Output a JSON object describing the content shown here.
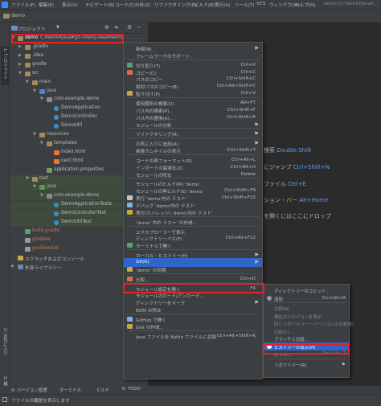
{
  "app": {
    "window_title": "demo [C:¥work¥java¥...",
    "menu": [
      "ファイル(F)",
      "編集(E)",
      "表示(V)",
      "ナビゲート(N)",
      "コード(C)",
      "分析(Z)",
      "リファクタリング(R)",
      "ビルド(B)",
      "実行(U)",
      "ツール(T)",
      "VCS",
      "ウィンドウ(W)",
      "ヘルプ(H)"
    ],
    "breadcrumb": "demo"
  },
  "left_strip": {
    "project_tab": "1: プロジェクト",
    "structure_tab": "2: 構造",
    "favorites_tab": "2: お気に入り"
  },
  "project_panel": {
    "title": "プロジェクト",
    "caret": "▼"
  },
  "tree": {
    "root_name": "demo",
    "root_path": "C:¥work¥java¥git-intellij-idea¥demo",
    "items": [
      {
        "label": ".gradle",
        "indent": 1,
        "arrow": "▶",
        "icon": "folder"
      },
      {
        "label": ".idea",
        "indent": 1,
        "arrow": "▶",
        "icon": "folder"
      },
      {
        "label": "gradle",
        "indent": 1,
        "arrow": "▶",
        "icon": "folder"
      },
      {
        "label": "src",
        "indent": 1,
        "arrow": "▼",
        "icon": "folder"
      },
      {
        "label": "main",
        "indent": 2,
        "arrow": "▼",
        "icon": "folder"
      },
      {
        "label": "java",
        "indent": 3,
        "arrow": "▼",
        "icon": "folder-blue"
      },
      {
        "label": "com.example.demo",
        "indent": 4,
        "arrow": "▼",
        "icon": "package"
      },
      {
        "label": "DemoApplication",
        "indent": 5,
        "arrow": "",
        "icon": "class"
      },
      {
        "label": "DemoController",
        "indent": 5,
        "arrow": "",
        "icon": "class"
      },
      {
        "label": "DemoUtil",
        "indent": 5,
        "arrow": "",
        "icon": "class"
      },
      {
        "label": "resources",
        "indent": 3,
        "arrow": "▼",
        "icon": "folder"
      },
      {
        "label": "templates",
        "indent": 4,
        "arrow": "▼",
        "icon": "folder"
      },
      {
        "label": "index.html",
        "indent": 5,
        "arrow": "",
        "icon": "html"
      },
      {
        "label": "next.html",
        "indent": 5,
        "arrow": "",
        "icon": "html"
      },
      {
        "label": "application.properties",
        "indent": 4,
        "arrow": "",
        "icon": "props"
      },
      {
        "label": "test",
        "indent": 2,
        "arrow": "▼",
        "icon": "folder"
      },
      {
        "label": "java",
        "indent": 3,
        "arrow": "▼",
        "icon": "folder-green"
      },
      {
        "label": "com.example.demo",
        "indent": 4,
        "arrow": "▼",
        "icon": "package"
      },
      {
        "label": "DemoApplicationTests",
        "indent": 5,
        "arrow": "",
        "icon": "class"
      },
      {
        "label": "DemoControllerTest",
        "indent": 5,
        "arrow": "",
        "icon": "class"
      },
      {
        "label": "DemoUtilTest",
        "indent": 5,
        "arrow": "",
        "icon": "class"
      },
      {
        "label": "build.gradle",
        "indent": 1,
        "arrow": "",
        "icon": "gradle"
      },
      {
        "label": "gradlew",
        "indent": 1,
        "arrow": "",
        "icon": "file"
      },
      {
        "label": "gradlew.bat",
        "indent": 1,
        "arrow": "",
        "icon": "file"
      },
      {
        "label": "スクラッチおよびコンソール",
        "indent": 0,
        "arrow": "",
        "icon": "scratch"
      },
      {
        "label": "外部ライブラリー",
        "indent": 0,
        "arrow": "▶",
        "icon": "library"
      }
    ]
  },
  "editor_hints": {
    "search_label": "検索",
    "search_key": "Double Shift",
    "jump_label": "にジャンプ",
    "jump_key": "Ctrl+Shift+N",
    "file_label": "ファイル",
    "file_key": "Ctrl+E",
    "nav_label": "ション・バー",
    "nav_key": "Alt+Home",
    "drop_label": "を開くにはここにドロップ"
  },
  "context_menu": {
    "items": [
      {
        "label": "新規(N)",
        "shortcut": "",
        "submenu": true
      },
      {
        "label": "フレームワークのサポート...",
        "shortcut": ""
      },
      {
        "sep": true
      },
      {
        "label": "切り取り(T)",
        "shortcut": "Ctrl+X",
        "icon": true
      },
      {
        "label": "コピー(C)",
        "shortcut": "Ctrl+C",
        "icon": true
      },
      {
        "label": "パスのコピー",
        "shortcut": "Ctrl+Shift+C"
      },
      {
        "label": "相対パスのコピー(B)",
        "shortcut": "Ctrl+Alt+Shift+C"
      },
      {
        "label": "貼り付け(P)",
        "shortcut": "Ctrl+V",
        "icon": true
      },
      {
        "sep": true
      },
      {
        "label": "使用箇所の検索(U)",
        "shortcut": "Alt+F7"
      },
      {
        "label": "パス内の検索(P)...",
        "shortcut": "Ctrl+Shift+F"
      },
      {
        "label": "パス内の置換(A)...",
        "shortcut": "Ctrl+Shift+R"
      },
      {
        "label": "モジュールの分析",
        "shortcut": "",
        "submenu": true
      },
      {
        "sep": true
      },
      {
        "label": "リファクタリング(R)",
        "shortcut": "",
        "submenu": true
      },
      {
        "sep": true
      },
      {
        "label": "お気に入りに追加(A)",
        "shortcut": "",
        "submenu": true
      },
      {
        "label": "画像サムネイルの表示",
        "shortcut": "Ctrl+Shift+T"
      },
      {
        "sep": true
      },
      {
        "label": "コードの再フォーマット(R)",
        "shortcut": "Ctrl+Alt+L"
      },
      {
        "label": "インポートの最適化(Z)",
        "shortcut": "Ctrl+Alt+O"
      },
      {
        "label": "モジュールの除去",
        "shortcut": "Delete"
      },
      {
        "sep": true
      },
      {
        "label": "モジュールのビルド(M) 'demo'",
        "shortcut": ""
      },
      {
        "label": "モジュールの再ビルド(E) 'demo'",
        "shortcut": "Ctrl+Shift+F9"
      },
      {
        "label": "実行 'demo'内の テスト'",
        "shortcut": "Ctrl+Shift+F10",
        "icon": true
      },
      {
        "label": "デバッグ 'demo'内の テスト'",
        "shortcut": "",
        "icon": true
      },
      {
        "label": "実行(カバレッジ) 'demo'内の テスト'",
        "shortcut": "",
        "icon": true
      },
      {
        "sep": true
      },
      {
        "label": "'demo' 内の テスト' の作成...",
        "shortcut": ""
      },
      {
        "sep": true
      },
      {
        "label": "エクスプローラーで表示",
        "shortcut": ""
      },
      {
        "label": "ディレクトリーパス(P)",
        "shortcut": "Ctrl+Alt+F12"
      },
      {
        "label": "ターミナルで開く",
        "shortcut": "",
        "icon": true
      },
      {
        "sep": true
      },
      {
        "label": "ローカル・ヒストリー(H)",
        "shortcut": "",
        "submenu": true
      },
      {
        "label": "Git(G)",
        "shortcut": "",
        "submenu": true,
        "highlight": true
      },
      {
        "label": "'demo' の同期",
        "shortcut": "",
        "icon": true
      },
      {
        "sep": true
      },
      {
        "label": "比較...",
        "shortcut": "Ctrl+D",
        "icon": true
      },
      {
        "sep": true
      },
      {
        "label": "モジュール設定を開く",
        "shortcut": "F4"
      },
      {
        "label": "モジュールのロード/アンロード...",
        "shortcut": ""
      },
      {
        "label": "ディレクトリーをマーク",
        "shortcut": "",
        "submenu": true
      },
      {
        "label": "BOM の除去",
        "shortcut": ""
      },
      {
        "sep": true
      },
      {
        "label": "GitHub で開く",
        "shortcut": "",
        "icon": true
      },
      {
        "label": "Gist の作成...",
        "shortcut": "",
        "icon": true
      },
      {
        "sep": true
      },
      {
        "label": "Java ファイルを Kotlin ファイルに変換",
        "shortcut": "Ctrl+Alt+Shift+K"
      }
    ]
  },
  "git_submenu": {
    "items": [
      {
        "label": "ディレクトリーのコミット...",
        "shortcut": ""
      },
      {
        "label": "追加",
        "shortcut": "Ctrl+Alt+A",
        "icon": true
      },
      {
        "sep": true
      },
      {
        "label": "注釈(N)",
        "shortcut": "",
        "dim": true
      },
      {
        "label": "現在のリビジョンを表示",
        "shortcut": "",
        "dim": true
      },
      {
        "label": "同じリポジトリー・バージョンと比較(E)",
        "shortcut": "",
        "dim": true
      },
      {
        "label": "比較(C)...",
        "shortcut": "",
        "dim": true
      },
      {
        "label": "ブランチと比較...",
        "shortcut": ""
      },
      {
        "label": "ヒストリーの表示(H)",
        "shortcut": "",
        "highlight": true
      },
      {
        "label": "戻す(R)...",
        "shortcut": "Ctrl+Alt+Z",
        "dim": true
      },
      {
        "sep": true
      },
      {
        "label": "リポジトリー(R)",
        "shortcut": "",
        "submenu": true
      }
    ]
  },
  "bottom_tabs": [
    "9: バージョン管理",
    "ターミナル",
    "ビルド",
    "6: TODO"
  ],
  "status": {
    "message": "ファイルの履歴を表示します"
  },
  "colors": {
    "accent": "#2f65ca",
    "highlight_box": "#e8202a",
    "link_blue": "#5a9ff0"
  }
}
